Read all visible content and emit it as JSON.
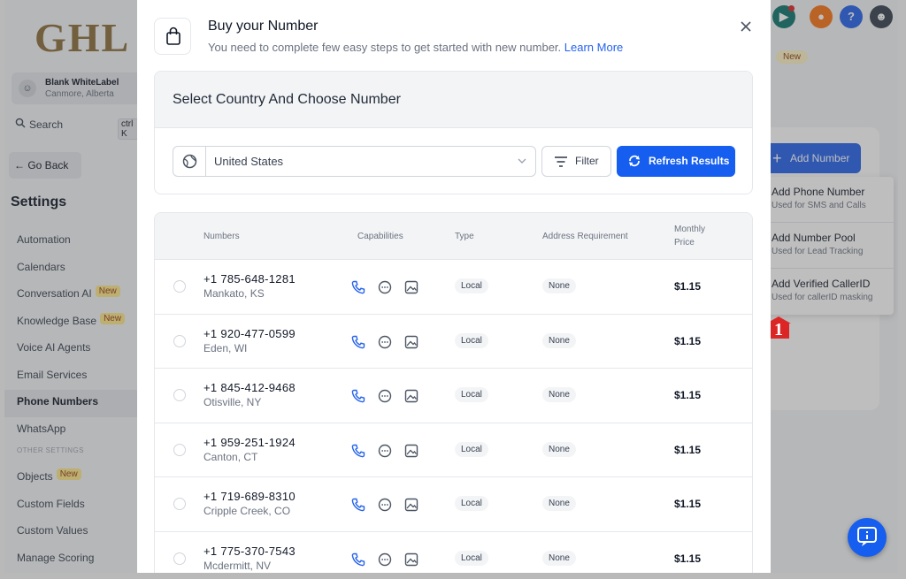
{
  "brand": {
    "logo_text": "GHL"
  },
  "account": {
    "name": "Blank WhiteLabel",
    "location": "Canmore, Alberta"
  },
  "search": {
    "label": "Search",
    "shortcut": "ctrl K"
  },
  "nav": {
    "go_back": "Go Back",
    "settings_title": "Settings",
    "items": [
      {
        "label": "Automation",
        "badge": ""
      },
      {
        "label": "Calendars",
        "badge": ""
      },
      {
        "label": "Conversation AI",
        "badge": "New"
      },
      {
        "label": "Knowledge Base",
        "badge": "New"
      },
      {
        "label": "Voice AI Agents",
        "badge": ""
      },
      {
        "label": "Email Services",
        "badge": ""
      },
      {
        "label": "Phone Numbers",
        "badge": "",
        "active": true
      },
      {
        "label": "WhatsApp",
        "badge": ""
      }
    ],
    "other_heading": "OTHER SETTINGS",
    "other_items": [
      {
        "label": "Objects",
        "badge": "New"
      },
      {
        "label": "Custom Fields",
        "badge": ""
      },
      {
        "label": "Custom Values",
        "badge": ""
      },
      {
        "label": "Manage Scoring",
        "badge": ""
      }
    ]
  },
  "topbar": {
    "help_label": "?"
  },
  "background": {
    "new_pill": "New",
    "add_number_label": "Add Number",
    "dropdown": [
      {
        "title": "Add Phone Number",
        "desc": "Used for SMS and Calls"
      },
      {
        "title": "Add Number Pool",
        "desc": "Used for Lead Tracking"
      },
      {
        "title": "Add Verified CallerID",
        "desc": "Used for callerID masking"
      }
    ],
    "annotation_number": "1"
  },
  "modal": {
    "title": "Buy your Number",
    "subtitle": "You need to complete few easy steps to get started with new number.",
    "learn_more": "Learn More",
    "section_title": "Select Country And Choose Number",
    "country": "United States",
    "filter_label": "Filter",
    "refresh_label": "Refresh Results",
    "columns": {
      "numbers": "Numbers",
      "capabilities": "Capabilities",
      "type": "Type",
      "address": "Address Requirement",
      "price_line1": "Monthly",
      "price_line2": "Price"
    },
    "rows": [
      {
        "number": "+1 785-648-1281",
        "location": "Mankato, KS",
        "type": "Local",
        "address": "None",
        "price": "$1.15"
      },
      {
        "number": "+1 920-477-0599",
        "location": "Eden, WI",
        "type": "Local",
        "address": "None",
        "price": "$1.15"
      },
      {
        "number": "+1 845-412-9468",
        "location": "Otisville, NY",
        "type": "Local",
        "address": "None",
        "price": "$1.15"
      },
      {
        "number": "+1 959-251-1924",
        "location": "Canton, CT",
        "type": "Local",
        "address": "None",
        "price": "$1.15"
      },
      {
        "number": "+1 719-689-8310",
        "location": "Cripple Creek, CO",
        "type": "Local",
        "address": "None",
        "price": "$1.15"
      },
      {
        "number": "+1 775-370-7543",
        "location": "Mcdermitt, NV",
        "type": "Local",
        "address": "None",
        "price": "$1.15"
      }
    ]
  },
  "colors": {
    "primary": "#155eef",
    "link": "#2563eb",
    "badge_bg": "#fde68a"
  }
}
